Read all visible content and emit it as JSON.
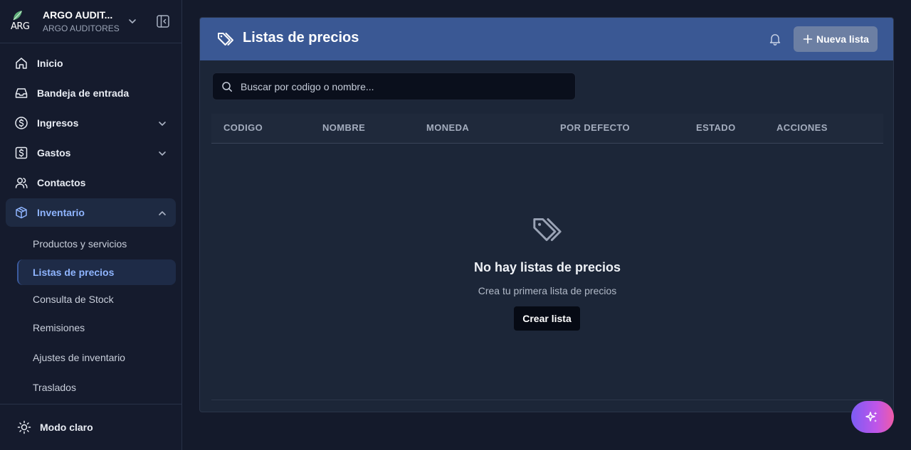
{
  "brand": {
    "name": "ARGO AUDIT...",
    "subtitle": "ARGO AUDITORES",
    "logo_text": "ARG"
  },
  "sidebar": {
    "items": [
      {
        "label": "Inicio",
        "icon": "home-icon"
      },
      {
        "label": "Bandeja de entrada",
        "icon": "inbox-icon"
      },
      {
        "label": "Ingresos",
        "icon": "dollar-circle-icon",
        "expandable": true
      },
      {
        "label": "Gastos",
        "icon": "dollar-square-icon",
        "expandable": true
      },
      {
        "label": "Contactos",
        "icon": "users-icon"
      },
      {
        "label": "Inventario",
        "icon": "box-icon",
        "expandable": true,
        "expanded": true,
        "active": true
      }
    ],
    "sub_items": [
      {
        "label": "Productos y servicios"
      },
      {
        "label": "Listas de precios",
        "active": true
      },
      {
        "label": "Consulta de Stock"
      },
      {
        "label": "Remisiones"
      },
      {
        "label": "Ajustes de inventario"
      },
      {
        "label": "Traslados"
      }
    ],
    "footer": {
      "mode_label": "Modo claro",
      "icon": "sun-icon"
    }
  },
  "header": {
    "title": "Listas de precios",
    "new_button": "Nueva lista"
  },
  "search": {
    "placeholder": "Buscar por codigo o nombre..."
  },
  "table": {
    "columns": [
      "CODIGO",
      "NOMBRE",
      "MONEDA",
      "POR DEFECTO",
      "ESTADO",
      "ACCIONES"
    ],
    "rows": []
  },
  "empty_state": {
    "title": "No hay listas de precios",
    "subtitle": "Crea tu primera lista de precios",
    "button": "Crear lista"
  },
  "colors": {
    "background": "#141a2b",
    "sidebar": "#151b2d",
    "header": "#3a5894",
    "accent": "#8fb5ff",
    "fab_start": "#7c5cf5",
    "fab_end": "#ef5ba8"
  }
}
